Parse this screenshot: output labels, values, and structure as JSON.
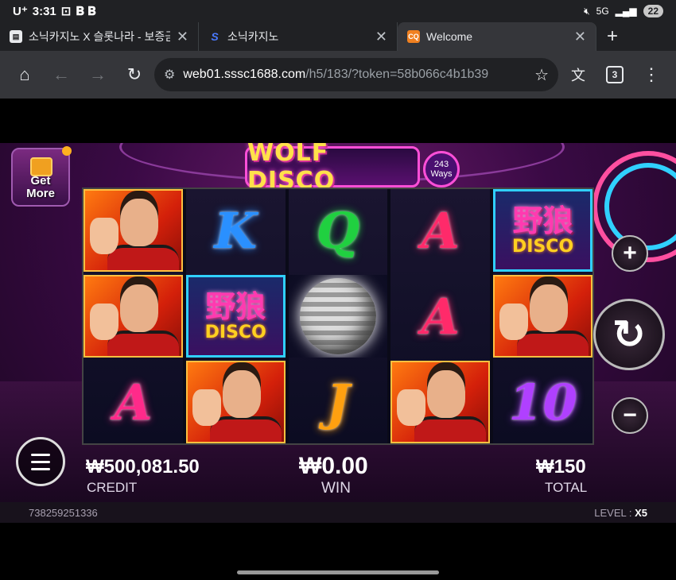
{
  "status": {
    "carrier": "U⁺",
    "time": "3:31",
    "battery": "22",
    "net": "5G"
  },
  "tabs": [
    {
      "title": "소닉카지노 X 슬롯나라 - 보증금",
      "favicon": "blog"
    },
    {
      "title": "소닉카지노",
      "favicon": "S"
    },
    {
      "title": "Welcome",
      "favicon": "CQ"
    }
  ],
  "toolbar": {
    "url_host": "web01.sssc1688.com",
    "url_path": "/h5/183/?token=58b066c4b1b39",
    "tab_count": "3"
  },
  "game": {
    "logo": "WOLF DISCO",
    "ways_number": "243",
    "ways_label": "Ways",
    "get_more": "Get More",
    "reels": [
      [
        {
          "type": "face"
        },
        {
          "type": "face"
        },
        {
          "type": "letter",
          "text": "A",
          "color": "#ff2a8a"
        }
      ],
      [
        {
          "type": "letter",
          "text": "K",
          "color": "#2a90ff"
        },
        {
          "type": "wild"
        },
        {
          "type": "face"
        }
      ],
      [
        {
          "type": "letter",
          "text": "Q",
          "color": "#20d040"
        },
        {
          "type": "disco"
        },
        {
          "type": "letter",
          "text": "J",
          "color": "#ffa010"
        }
      ],
      [
        {
          "type": "letter",
          "text": "A",
          "color": "#ff2a6a"
        },
        {
          "type": "letter",
          "text": "A",
          "color": "#ff2a6a"
        },
        {
          "type": "face"
        }
      ],
      [
        {
          "type": "wild"
        },
        {
          "type": "face"
        },
        {
          "type": "letter",
          "text": "10",
          "color": "#b040ff"
        }
      ]
    ],
    "wild_cn": "野狼",
    "wild_en": "DISCO",
    "credit_value": "₩500,081.50",
    "credit_label": "CREDIT",
    "win_value": "₩0.00",
    "win_label": "WIN",
    "total_value": "₩150",
    "total_label": "TOTAL",
    "round_id": "738259251336",
    "level_label": "LEVEL :",
    "level_value": "X5"
  }
}
